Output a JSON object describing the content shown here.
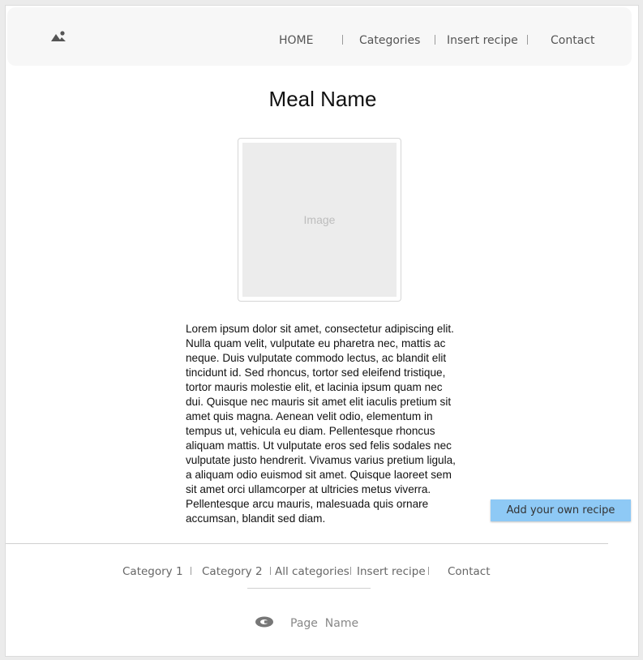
{
  "header": {
    "logo_icon": "image-landscape-icon",
    "nav": [
      {
        "label": "HOME"
      },
      {
        "label": "Categories"
      },
      {
        "label": "Insert recipe"
      },
      {
        "label": "Contact"
      }
    ]
  },
  "main": {
    "title": "Meal Name",
    "image_placeholder": "Image",
    "description": "Lorem ipsum dolor sit amet, consectetur adipiscing elit. Nulla quam velit, vulputate eu pharetra nec, mattis ac neque. Duis vulputate commodo lectus, ac blandit elit tincidunt id. Sed rhoncus, tortor sed eleifend tristique, tortor mauris molestie elit, et lacinia ipsum quam nec dui. Quisque nec mauris sit amet elit iaculis pretium sit amet quis magna. Aenean velit odio, elementum in tempus ut, vehicula eu diam. Pellentesque rhoncus aliquam mattis. Ut vulputate eros sed felis sodales nec vulputate justo hendrerit. Vivamus varius pretium ligula, a aliquam odio euismod sit amet. Quisque laoreet sem sit amet orci ullamcorper at ultricies metus viverra. Pellentesque arcu mauris, malesuada quis ornare accumsan, blandit sed diam."
  },
  "actions": {
    "add_recipe_label": "Add your own recipe",
    "add_recipe_color": "#8ec9f5"
  },
  "footer": {
    "links": [
      {
        "label": "Category 1"
      },
      {
        "label": "Category 2"
      },
      {
        "label": "All categories"
      },
      {
        "label": "Insert recipe"
      },
      {
        "label": "Contact"
      }
    ],
    "copyright_icon": "copyright-icon",
    "page_name": "Page  Name"
  }
}
